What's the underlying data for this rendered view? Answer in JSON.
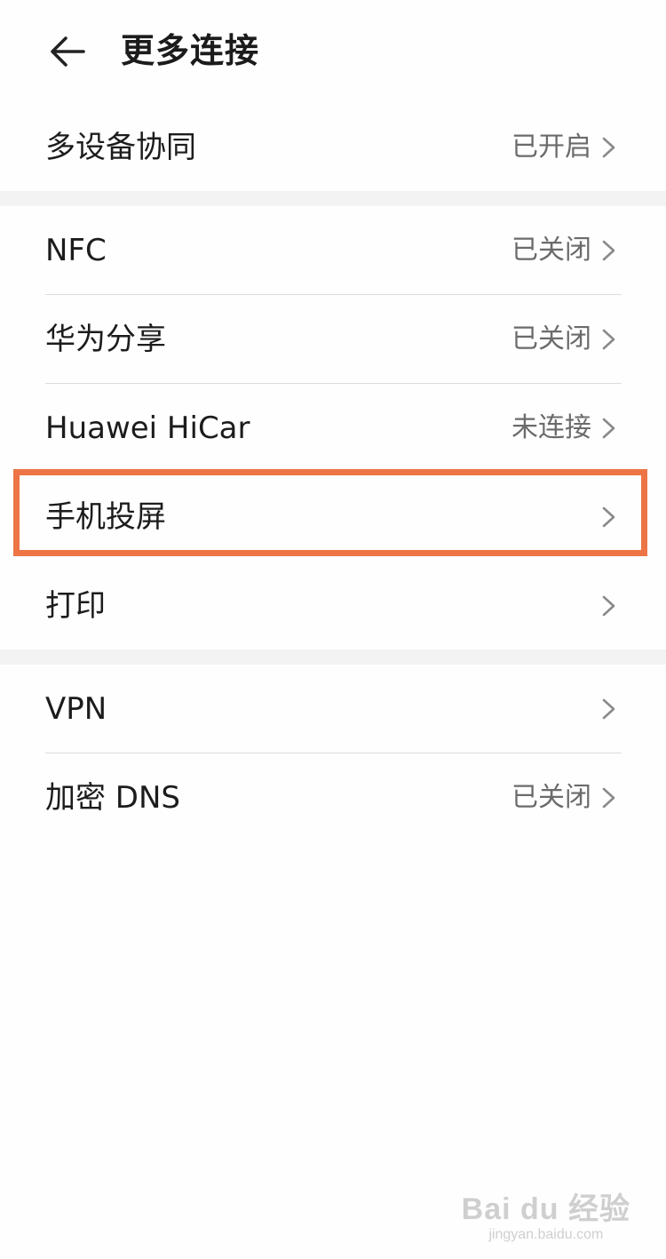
{
  "header": {
    "back_icon": "arrow-left-icon",
    "title": "更多连接"
  },
  "groups": [
    {
      "rows": [
        {
          "label": "多设备协同",
          "status": "已开启"
        }
      ]
    },
    {
      "rows": [
        {
          "label": "NFC",
          "status": "已关闭"
        },
        {
          "label": "华为分享",
          "status": "已关闭"
        },
        {
          "label": "Huawei HiCar",
          "status": "未连接"
        },
        {
          "label": "手机投屏",
          "status": ""
        },
        {
          "label": "打印",
          "status": ""
        }
      ]
    },
    {
      "rows": [
        {
          "label": "VPN",
          "status": ""
        },
        {
          "label": "加密 DNS",
          "status": "已关闭"
        }
      ]
    }
  ],
  "highlight": {
    "color": "#ed7545",
    "target": "手机投屏"
  },
  "watermark": {
    "main": "Bai du 经验",
    "sub": "jingyan.baidu.com"
  },
  "icons": {
    "chevron": "chevron-right-icon"
  }
}
